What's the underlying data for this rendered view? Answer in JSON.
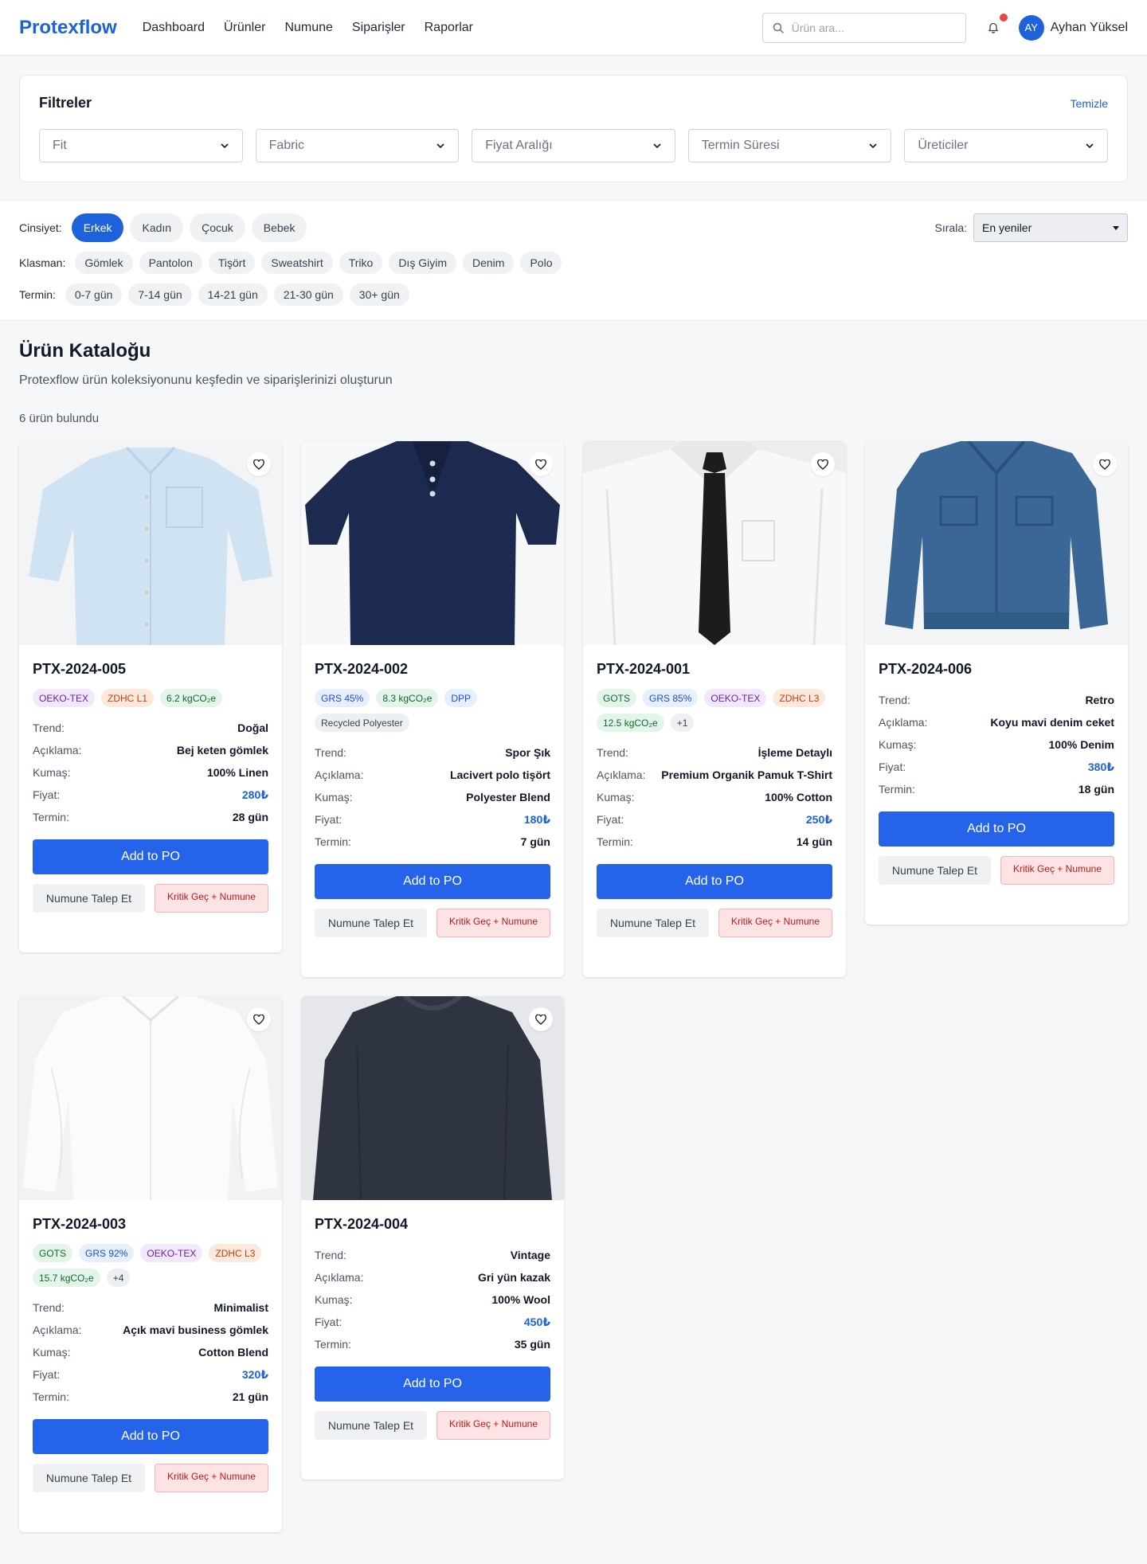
{
  "header": {
    "logo": "Protexflow",
    "nav": [
      "Dashboard",
      "Ürünler",
      "Numune",
      "Siparişler",
      "Raporlar"
    ],
    "search_placeholder": "Ürün ara...",
    "avatar_initials": "AY",
    "user_name": "Ayhan Yüksel",
    "has_notification": true
  },
  "filters": {
    "title": "Filtreler",
    "clear_label": "Temizle",
    "dropdowns": [
      "Fit",
      "Fabric",
      "Fiyat Aralığı",
      "Termin Süresi",
      "Üreticiler"
    ]
  },
  "chips": {
    "gender_label": "Cinsiyet:",
    "gender": [
      "Erkek",
      "Kadın",
      "Çocuk",
      "Bebek"
    ],
    "gender_active": "Erkek",
    "category_label": "Klasman:",
    "categories": [
      "Gömlek",
      "Pantolon",
      "Tişört",
      "Sweatshirt",
      "Triko",
      "Dış Giyim",
      "Denim",
      "Polo"
    ],
    "lead_label": "Termin:",
    "lead_times": [
      "0-7 gün",
      "7-14 gün",
      "14-21 gün",
      "21-30 gün",
      "30+ gün"
    ],
    "sort_label": "Sırala:",
    "sort_value": "En yeniler"
  },
  "catalog": {
    "title": "Ürün Kataloğu",
    "subtitle": "Protexflow ürün koleksiyonunu keşfedin ve siparişlerinizi oluşturun",
    "count_text": "6 ürün bulundu"
  },
  "labels": {
    "trend": "Trend:",
    "description": "Açıklama:",
    "fabric": "Kumaş:",
    "price": "Fiyat:",
    "lead": "Termin:",
    "add_to_po": "Add to PO",
    "request_sample": "Numune Talep Et",
    "critical": "Kritik Geç + Numune"
  },
  "products": [
    {
      "code": "PTX-2024-005",
      "image": "light-blue-shirt",
      "badges": [
        {
          "text": "OEKO-TEX",
          "tone": "purple"
        },
        {
          "text": "ZDHC L1",
          "tone": "orange"
        },
        {
          "text": "6.2 kgCO₂e",
          "tone": "green"
        }
      ],
      "trend": "Doğal",
      "description": "Bej keten gömlek",
      "fabric": "100% Linen",
      "price": "280₺",
      "lead": "28 gün"
    },
    {
      "code": "PTX-2024-002",
      "image": "navy-polo",
      "badges": [
        {
          "text": "GRS 45%",
          "tone": "blue"
        },
        {
          "text": "8.3 kgCO₂e",
          "tone": "green"
        },
        {
          "text": "DPP",
          "tone": "blue"
        },
        {
          "text": "Recycled Polyester",
          "tone": "gray"
        }
      ],
      "trend": "Spor Şık",
      "description": "Lacivert polo tişört",
      "fabric": "Polyester Blend",
      "price": "180₺",
      "lead": "7 gün"
    },
    {
      "code": "PTX-2024-001",
      "image": "white-shirt-tie",
      "badges": [
        {
          "text": "GOTS",
          "tone": "green"
        },
        {
          "text": "GRS 85%",
          "tone": "blue"
        },
        {
          "text": "OEKO-TEX",
          "tone": "purple"
        },
        {
          "text": "ZDHC L3",
          "tone": "orange"
        },
        {
          "text": "12.5 kgCO₂e",
          "tone": "green"
        },
        {
          "text": "+1",
          "tone": "gray"
        }
      ],
      "trend": "İşleme Detaylı",
      "description": "Premium Organik Pamuk T-Shirt",
      "fabric": "100% Cotton",
      "price": "250₺",
      "lead": "14 gün"
    },
    {
      "code": "PTX-2024-006",
      "image": "denim-jacket",
      "badges": [],
      "trend": "Retro",
      "description": "Koyu mavi denim ceket",
      "fabric": "100% Denim",
      "price": "380₺",
      "lead": "18 gün"
    },
    {
      "code": "PTX-2024-003",
      "image": "white-shirt",
      "badges": [
        {
          "text": "GOTS",
          "tone": "green"
        },
        {
          "text": "GRS 92%",
          "tone": "blue"
        },
        {
          "text": "OEKO-TEX",
          "tone": "purple"
        },
        {
          "text": "ZDHC L3",
          "tone": "orange"
        },
        {
          "text": "15.7 kgCO₂e",
          "tone": "green"
        },
        {
          "text": "+4",
          "tone": "gray"
        }
      ],
      "trend": "Minimalist",
      "description": "Açık mavi business gömlek",
      "fabric": "Cotton Blend",
      "price": "320₺",
      "lead": "21 gün"
    },
    {
      "code": "PTX-2024-004",
      "image": "gray-sweater",
      "badges": [],
      "trend": "Vintage",
      "description": "Gri yün kazak",
      "fabric": "100% Wool",
      "price": "450₺",
      "lead": "35 gün"
    }
  ],
  "colors": {
    "accent": "#1d62db",
    "button": "#2563eb",
    "notification": "#ef4444"
  }
}
